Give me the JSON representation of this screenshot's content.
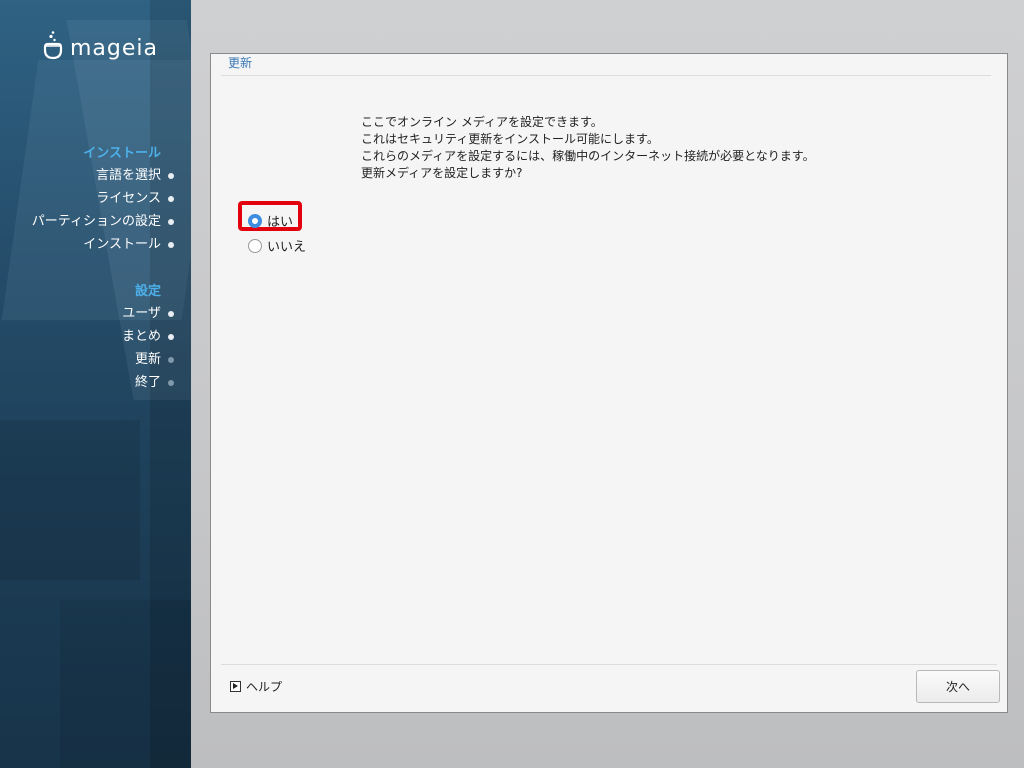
{
  "brand": {
    "name": "mageia",
    "logo_icon": "mageia-cauldron-icon"
  },
  "sidebar": {
    "install_heading": "インストール",
    "install_items": [
      {
        "label": "言語を選択",
        "state": "done"
      },
      {
        "label": "ライセンス",
        "state": "done"
      },
      {
        "label": "パーティションの設定",
        "state": "done"
      },
      {
        "label": "インストール",
        "state": "done"
      }
    ],
    "config_heading": "設定",
    "config_items": [
      {
        "label": "ユーザ",
        "state": "done"
      },
      {
        "label": "まとめ",
        "state": "done"
      },
      {
        "label": "更新",
        "state": "pending"
      },
      {
        "label": "終了",
        "state": "pending"
      }
    ]
  },
  "dialog": {
    "section_title": "更新",
    "intro_lines": [
      "ここでオンライン メディアを設定できます。",
      "これはセキュリティ更新をインストール可能にします。",
      "これらのメディアを設定するには、稼働中のインターネット接続が必要となります。",
      "更新メディアを設定しますか?"
    ],
    "options": [
      {
        "label": "はい",
        "selected": true
      },
      {
        "label": "いいえ",
        "selected": false
      }
    ],
    "help_label": "ヘルプ",
    "next_label": "次へ"
  },
  "colors": {
    "accent": "#3d8ee0",
    "heading": "#4db0ea",
    "highlight": "#e3000f",
    "sidebar": "#264f6d"
  }
}
